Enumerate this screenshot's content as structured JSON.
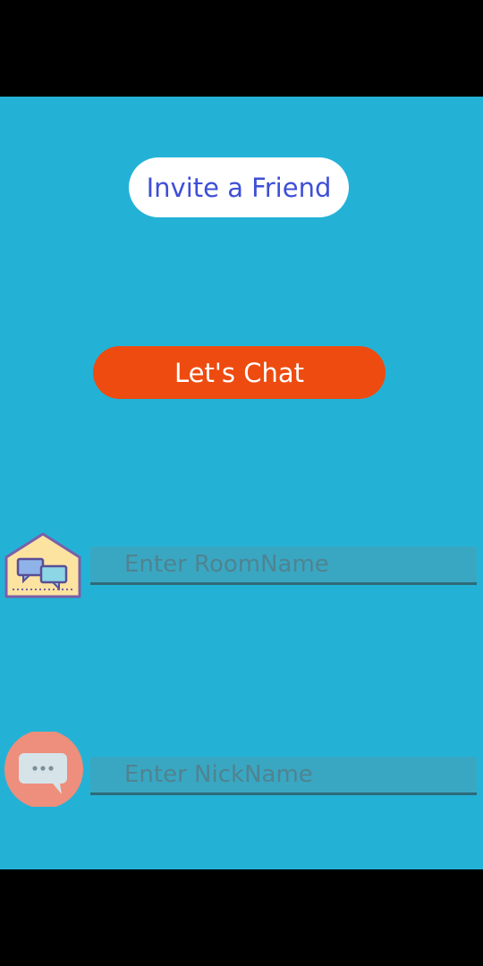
{
  "buttons": {
    "invite_label": "Invite a Friend",
    "chat_label": "Let's Chat"
  },
  "fields": {
    "room": {
      "placeholder": "Enter RoomName",
      "value": ""
    },
    "nick": {
      "placeholder": "Enter NickName",
      "value": ""
    }
  },
  "icons": {
    "room": "house-chat-icon",
    "nick": "chat-bubble-icon"
  },
  "colors": {
    "background": "#23B2D6",
    "invite_text": "#3F4FD6",
    "chat_button": "#EE4B10",
    "house_fill": "#FCE3A0",
    "bubble_circle": "#EE8E7C"
  }
}
